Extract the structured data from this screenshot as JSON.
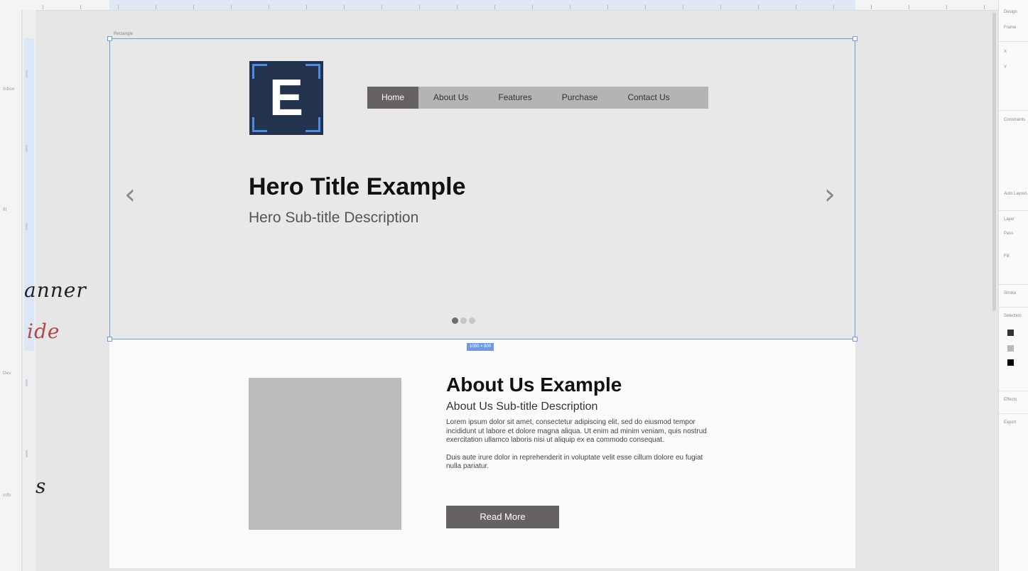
{
  "canvas": {
    "frame_label": "Rectangle",
    "size_badge": "1050 × 800",
    "notes": [
      "anner",
      "ide",
      "s"
    ],
    "ruler_labels": [
      "Inbox",
      "Ill",
      "Dev",
      "Info"
    ]
  },
  "hero": {
    "logo_letter": "E",
    "nav": [
      {
        "label": "Home",
        "active": true
      },
      {
        "label": "About Us",
        "active": false
      },
      {
        "label": "Features",
        "active": false
      },
      {
        "label": "Purchase",
        "active": false
      },
      {
        "label": "Contact Us",
        "active": false
      }
    ],
    "prev_arrow": "‹",
    "next_arrow": "›",
    "title": "Hero Title Example",
    "subtitle": "Hero Sub-title Description",
    "slides": 3,
    "active_slide": 0
  },
  "about": {
    "title": "About Us Example",
    "subtitle": "About Us Sub-title Description",
    "paragraph1": "Lorem ipsum dolor sit amet, consectetur adipiscing elit, sed do eiusmod tempor incididunt ut labore et dolore magna aliqua. Ut enim ad minim veniam, quis nostrud exercitation ullamco laboris nisi ut aliquip ex ea commodo consequat.",
    "paragraph2": "Duis aute irure dolor in reprehenderit in voluptate velit esse cillum dolore eu fugiat nulla pariatur.",
    "button": "Read More"
  },
  "panel": {
    "title": "Design",
    "labels": [
      "Frame",
      "X",
      "Y",
      "Constraints",
      "Auto Layout",
      "Layer",
      "Pass",
      "Fill",
      "Stroke",
      "Selection",
      "Effects",
      "Export"
    ],
    "colors": [
      "#333333",
      "#b9b9b9",
      "#000000"
    ]
  },
  "colors": {
    "accent": "#6e9ae2",
    "nav_active": "#666263",
    "nav_bg": "#b6b3b3",
    "logo_bg": "#23324d",
    "logo_frame": "#4d8ce0"
  }
}
